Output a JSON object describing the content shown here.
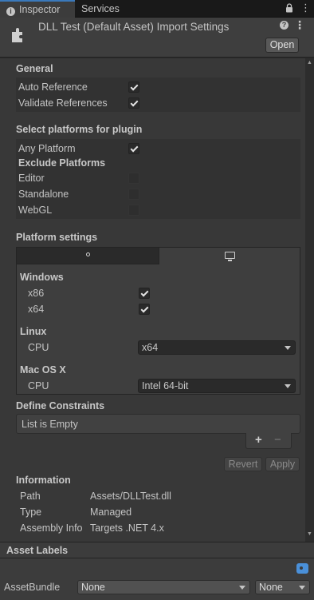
{
  "tabs": {
    "inspector": "Inspector",
    "services": "Services"
  },
  "header": {
    "title": "DLL Test (Default Asset) Import Settings",
    "open": "Open"
  },
  "general": {
    "heading": "General",
    "auto_reference": "Auto Reference",
    "auto_reference_checked": true,
    "validate_references": "Validate References",
    "validate_references_checked": true
  },
  "platforms": {
    "heading": "Select platforms for plugin",
    "any_platform": "Any Platform",
    "any_platform_checked": true,
    "exclude_heading": "Exclude Platforms",
    "items": [
      {
        "label": "Editor",
        "checked": false
      },
      {
        "label": "Standalone",
        "checked": false
      },
      {
        "label": "WebGL",
        "checked": false
      }
    ]
  },
  "platform_settings": {
    "heading": "Platform settings",
    "windows": {
      "heading": "Windows",
      "x86": "x86",
      "x86_checked": true,
      "x64": "x64",
      "x64_checked": true
    },
    "linux": {
      "heading": "Linux",
      "cpu_label": "CPU",
      "cpu_value": "x64"
    },
    "mac": {
      "heading": "Mac OS X",
      "cpu_label": "CPU",
      "cpu_value": "Intel 64-bit"
    }
  },
  "define_constraints": {
    "heading": "Define Constraints",
    "empty": "List is Empty",
    "add": "+",
    "remove": "−"
  },
  "actions": {
    "revert": "Revert",
    "apply": "Apply"
  },
  "information": {
    "heading": "Information",
    "rows": [
      {
        "key": "Path",
        "value": "Assets/DLLTest.dll"
      },
      {
        "key": "Type",
        "value": "Managed"
      },
      {
        "key": "Assembly Info",
        "value": "Targets .NET 4.x"
      }
    ]
  },
  "asset_labels": {
    "heading": "Asset Labels"
  },
  "asset_bundle": {
    "label": "AssetBundle",
    "value": "None",
    "variant": "None"
  },
  "icons": {
    "lock": "lock-icon",
    "more": "more-icon",
    "help": "help-icon",
    "tag": "tag-icon"
  },
  "colors": {
    "accent": "#3a79bb",
    "tag": "#4a90d9"
  }
}
